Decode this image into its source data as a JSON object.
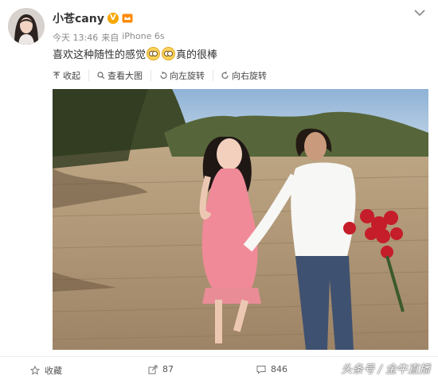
{
  "post": {
    "username": "小苍cany",
    "verified_badge": "V",
    "time": "今天 13:46",
    "source_prefix": "来自",
    "device": "iPhone 6s",
    "text_before": "喜欢这种随性的感觉",
    "text_after": "真的很棒",
    "emoji_names": [
      "eyes-emoji",
      "eyes-emoji"
    ]
  },
  "toolbar": {
    "collapse": "收起",
    "view_large": "查看大图",
    "rotate_left": "向左旋转",
    "rotate_right": "向右旋转"
  },
  "footer": {
    "favorite": "收藏",
    "repost_count": "87",
    "comment_count": "846"
  },
  "watermark": "头条号 / 金牛直播",
  "colors": {
    "badge": "#f7a600",
    "text": "#333333",
    "muted": "#8a8a8a"
  }
}
